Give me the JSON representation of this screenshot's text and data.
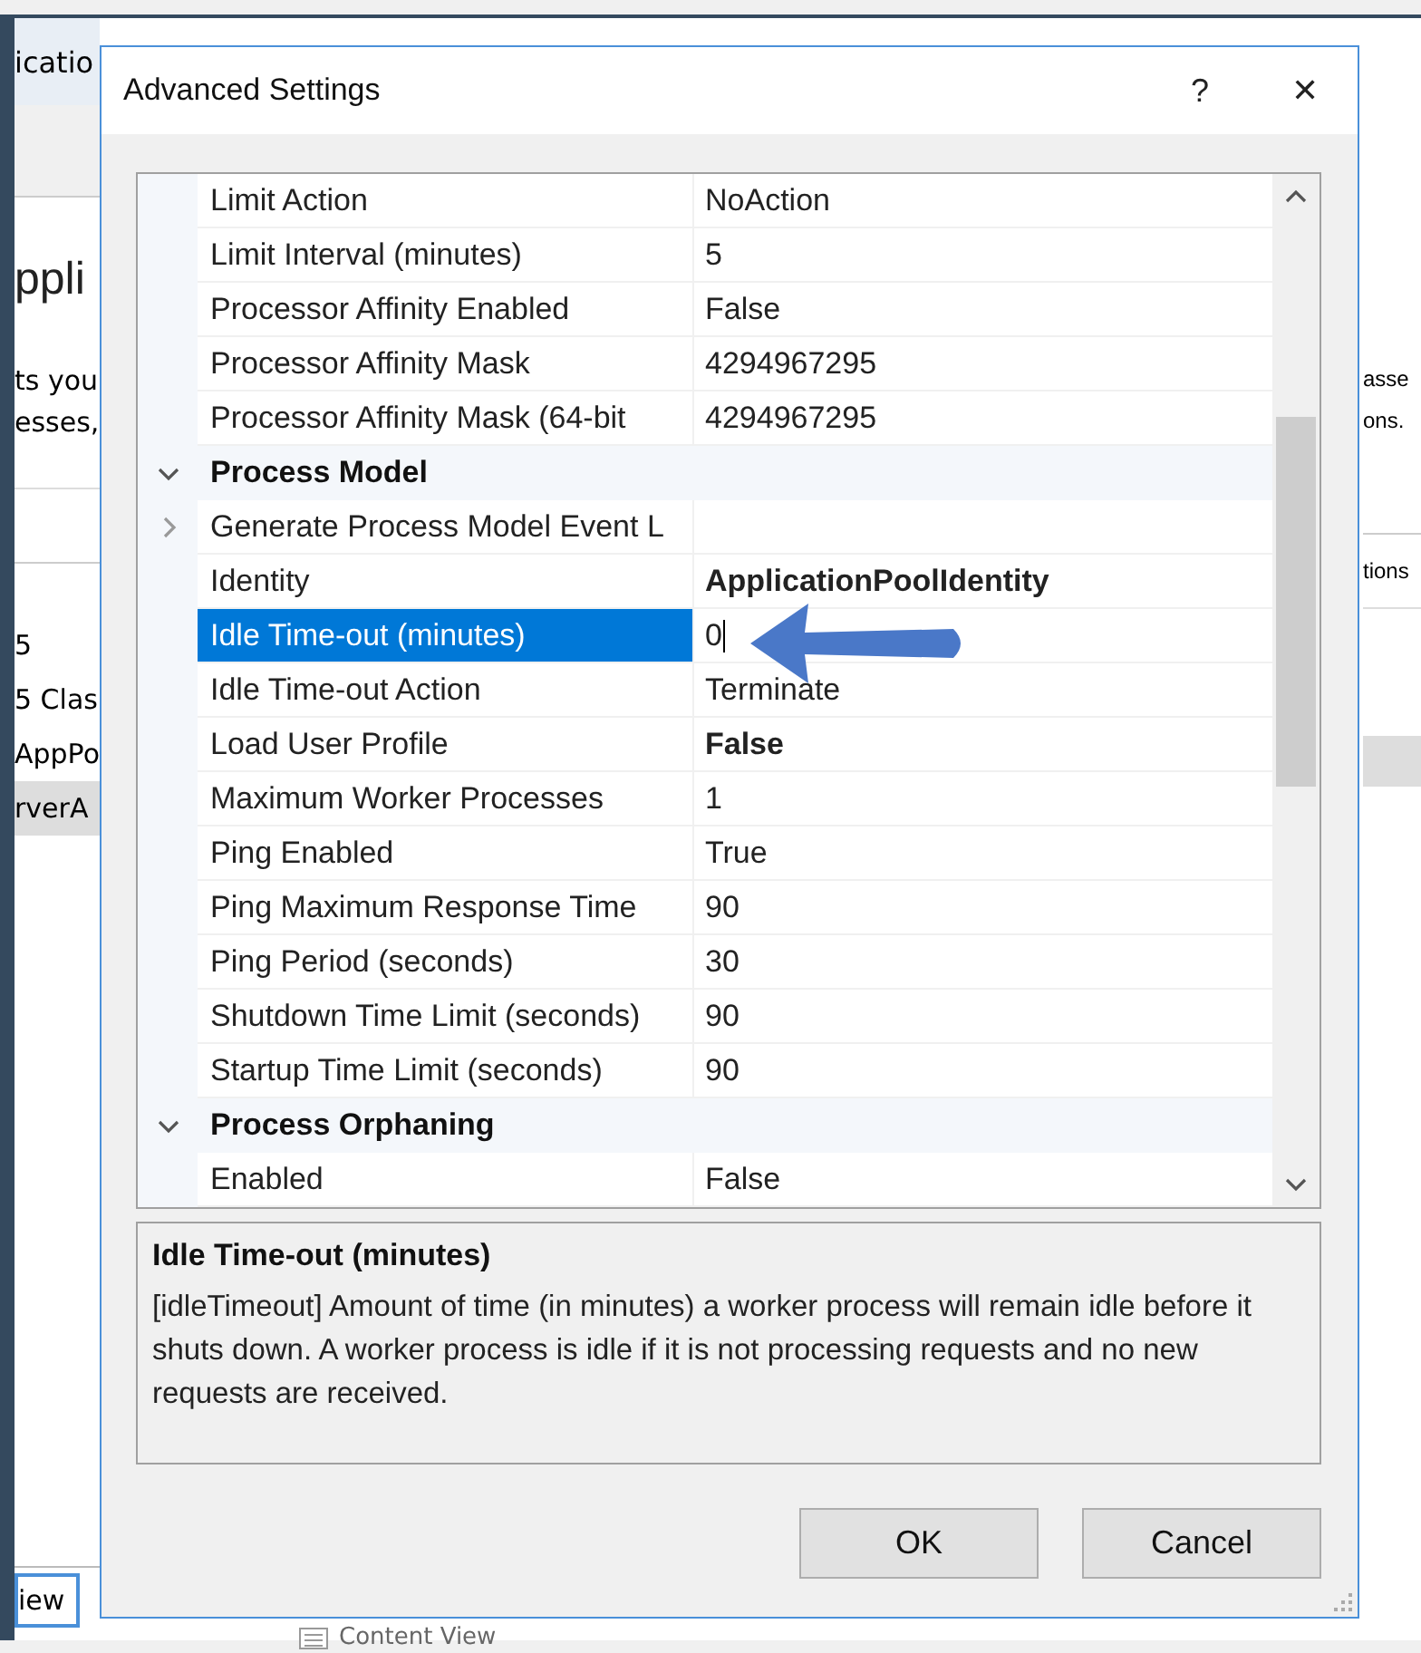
{
  "background_window": {
    "tab_fragment": "icatio",
    "heading_fragment": "ppli",
    "text_fragments_left": [
      "ts you",
      "esses,"
    ],
    "text_fragments_right": [
      "asse",
      "ons."
    ],
    "column_fragment": "tions",
    "list_fragments": [
      {
        "text": "5",
        "selected": false
      },
      {
        "text": "5 Clas",
        "selected": false
      },
      {
        "text": "AppPo",
        "selected": false
      },
      {
        "text": "rverA",
        "selected": true
      }
    ],
    "bottom_tabs": [
      {
        "label": "iew",
        "selected": true
      },
      {
        "label": "Content View",
        "selected": false
      }
    ]
  },
  "dialog": {
    "title": "Advanced Settings",
    "help": "?",
    "close": "✕",
    "properties": [
      {
        "kind": "property",
        "name": "Limit Action",
        "value": "NoAction",
        "bold": false,
        "selected": false
      },
      {
        "kind": "property",
        "name": "Limit Interval (minutes)",
        "value": "5",
        "bold": false,
        "selected": false
      },
      {
        "kind": "property",
        "name": "Processor Affinity Enabled",
        "value": "False",
        "bold": false,
        "selected": false
      },
      {
        "kind": "property",
        "name": "Processor Affinity Mask",
        "value": "4294967295",
        "bold": false,
        "selected": false
      },
      {
        "kind": "property",
        "name": "Processor Affinity Mask (64-bit",
        "value": "4294967295",
        "bold": false,
        "selected": false
      },
      {
        "kind": "category",
        "name": "Process Model",
        "expanded": true,
        "children": [
          {
            "kind": "expandable",
            "name": "Generate Process Model Event L",
            "expanded": false,
            "selected": false
          },
          {
            "kind": "property",
            "name": "Identity",
            "value": "ApplicationPoolIdentity",
            "bold": true,
            "selected": false
          },
          {
            "kind": "property",
            "name": "Idle Time-out (minutes)",
            "value": "0",
            "bold": false,
            "selected": true
          },
          {
            "kind": "property",
            "name": "Idle Time-out Action",
            "value": "Terminate",
            "bold": false,
            "selected": false
          },
          {
            "kind": "property",
            "name": "Load User Profile",
            "value": "False",
            "bold": true,
            "selected": false
          },
          {
            "kind": "property",
            "name": "Maximum Worker Processes",
            "value": "1",
            "bold": false,
            "selected": false
          },
          {
            "kind": "property",
            "name": "Ping Enabled",
            "value": "True",
            "bold": false,
            "selected": false
          },
          {
            "kind": "property",
            "name": "Ping Maximum Response Time",
            "value": "90",
            "bold": false,
            "selected": false
          },
          {
            "kind": "property",
            "name": "Ping Period (seconds)",
            "value": "30",
            "bold": false,
            "selected": false
          },
          {
            "kind": "property",
            "name": "Shutdown Time Limit (seconds)",
            "value": "90",
            "bold": false,
            "selected": false
          },
          {
            "kind": "property",
            "name": "Startup Time Limit (seconds)",
            "value": "90",
            "bold": false,
            "selected": false
          }
        ]
      },
      {
        "kind": "category",
        "name": "Process Orphaning",
        "expanded": true,
        "children": [
          {
            "kind": "property",
            "name": "Enabled",
            "value": "False",
            "bold": false,
            "selected": false
          }
        ]
      }
    ],
    "description": {
      "title": "Idle Time-out (minutes)",
      "text": "[idleTimeout] Amount of time (in minutes) a worker process will remain idle before it shuts down. A worker process is idle if it is not processing requests and no new requests are received."
    },
    "buttons": [
      "OK",
      "Cancel"
    ]
  }
}
